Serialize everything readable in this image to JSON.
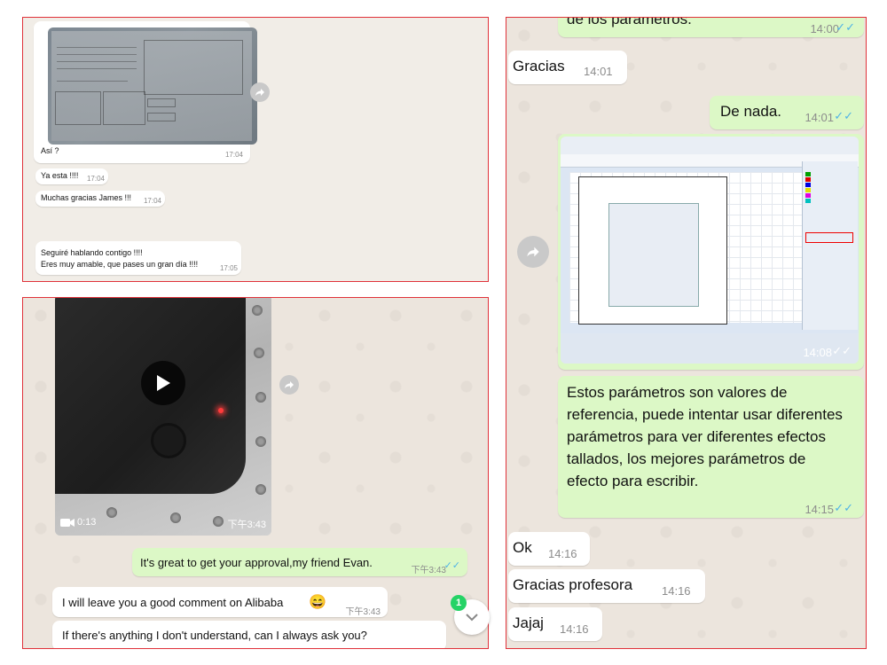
{
  "panel1": {
    "messages": [
      {
        "text": "Así ?",
        "time": "17:04"
      },
      {
        "text": "Ya esta !!!!",
        "time": "17:04"
      },
      {
        "text": "Muchas gracias James !!!",
        "time": "17:04"
      },
      {
        "text": "Seguiré hablando contigo !!!!\nEres muy amable, que pases un gran día  !!!!",
        "time": "17:05"
      }
    ]
  },
  "panel2": {
    "video": {
      "duration": "0:13",
      "time": "下午3:43"
    },
    "messages": [
      {
        "text": "It's great to get your approval,my friend Evan.",
        "time": "下午3:43",
        "direction": "out"
      },
      {
        "text": "I will leave you a good comment on Alibaba",
        "emoji": "😄",
        "time": "下午3:43",
        "direction": "in"
      },
      {
        "text": "If there's anything I don't understand, can I always ask you?",
        "direction": "in"
      }
    ],
    "unread_badge": "1"
  },
  "panel3": {
    "top_partial": {
      "text": "de los parámetros.",
      "time": "14:00"
    },
    "messages": [
      {
        "text": "Gracias",
        "time": "14:01",
        "direction": "in"
      },
      {
        "text": "De nada.",
        "time": "14:01",
        "direction": "out"
      },
      {
        "image_time": "14:08",
        "direction": "out"
      },
      {
        "text": "Estos parámetros son valores de referencia, puede intentar usar diferentes parámetros para ver diferentes efectos tallados, los mejores parámetros de efecto para escribir.",
        "time": "14:15",
        "direction": "out"
      },
      {
        "text": "Ok",
        "time": "14:16",
        "direction": "in"
      },
      {
        "text": "Gracias profesora",
        "time": "14:16",
        "direction": "in"
      },
      {
        "text": "Jajaj",
        "time": "14:16",
        "direction": "in"
      }
    ]
  },
  "colors": {
    "outgoing": "#dcf8c6",
    "incoming": "#ffffff",
    "ticks": "#4fb3e6",
    "panel_border": "#e0323a",
    "badge": "#25d366"
  }
}
